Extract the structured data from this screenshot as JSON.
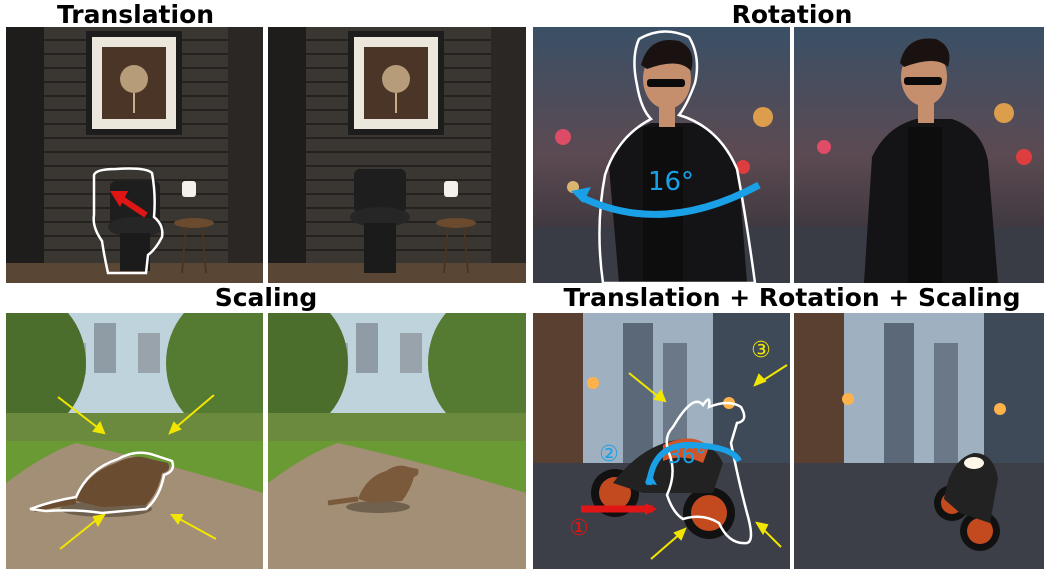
{
  "titles": {
    "translation": "Translation",
    "rotation": "Rotation",
    "scaling": "Scaling",
    "combined": "Translation + Rotation + Scaling"
  },
  "annotations": {
    "rotation_angle": "16°",
    "combined_angle": "36°",
    "step1": "①",
    "step2": "②",
    "step3": "③"
  },
  "colors": {
    "arrow_red": "#e01515",
    "arrow_blue": "#1aa0e6",
    "arrow_yellow": "#f2e600",
    "outline": "#ffffff"
  }
}
